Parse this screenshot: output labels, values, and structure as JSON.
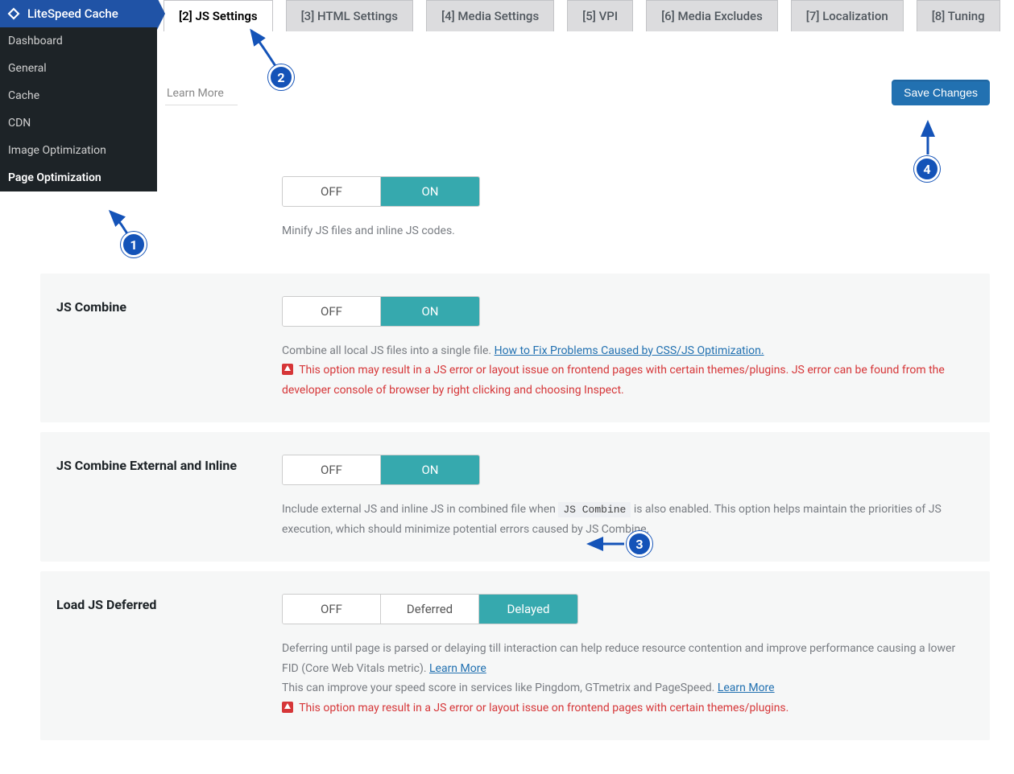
{
  "sidebar": {
    "title": "LiteSpeed Cache",
    "items": [
      {
        "label": "Dashboard"
      },
      {
        "label": "General"
      },
      {
        "label": "Cache"
      },
      {
        "label": "CDN"
      },
      {
        "label": "Image Optimization"
      },
      {
        "label": "Page Optimization"
      }
    ],
    "active_index": 5
  },
  "tabs": {
    "items": [
      {
        "label": "[2] JS Settings"
      },
      {
        "label": "[3] HTML Settings"
      },
      {
        "label": "[4] Media Settings"
      },
      {
        "label": "[5] VPI"
      },
      {
        "label": "[6] Media Excludes"
      },
      {
        "label": "[7] Localization"
      },
      {
        "label": "[8] Tuning"
      }
    ],
    "active_index": 0
  },
  "topbar": {
    "learn_more": "Learn More",
    "save": "Save Changes"
  },
  "settings": [
    {
      "key": "js_minify",
      "label": "",
      "grey": false,
      "options": [
        "OFF",
        "ON"
      ],
      "selected": 1,
      "desc": "Minify JS files and inline JS codes.",
      "link": null,
      "warn": null
    },
    {
      "key": "js_combine",
      "label": "JS Combine",
      "grey": true,
      "options": [
        "OFF",
        "ON"
      ],
      "selected": 1,
      "desc": "Combine all local JS files into a single file. ",
      "link": "How to Fix Problems Caused by CSS/JS Optimization.",
      "warn": "This option may result in a JS error or layout issue on frontend pages with certain themes/plugins. JS error can be found from the developer console of browser by right clicking and choosing Inspect."
    },
    {
      "key": "js_combine_ext",
      "label": "JS Combine External and Inline",
      "grey": true,
      "options": [
        "OFF",
        "ON"
      ],
      "selected": 1,
      "desc_pre": "Include external JS and inline JS in combined file when ",
      "code": "JS Combine",
      "desc_post": " is also enabled. This option helps maintain the priorities of JS execution, which should minimize potential errors caused by JS Combine.",
      "link": null,
      "warn": null
    },
    {
      "key": "js_defer",
      "label": "Load JS Deferred",
      "grey": true,
      "options": [
        "OFF",
        "Deferred",
        "Delayed"
      ],
      "selected": 2,
      "desc": "Deferring until page is parsed or delaying till interaction can help reduce resource contention and improve performance causing a lower FID (Core Web Vitals metric). ",
      "link": "Learn More",
      "desc2": "This can improve your speed score in services like Pingdom, GTmetrix and PageSpeed. ",
      "link2": "Learn More",
      "warn": "This option may result in a JS error or layout issue on frontend pages with certain themes/plugins."
    }
  ],
  "steps": {
    "1": "1",
    "2": "2",
    "3": "3",
    "4": "4"
  }
}
